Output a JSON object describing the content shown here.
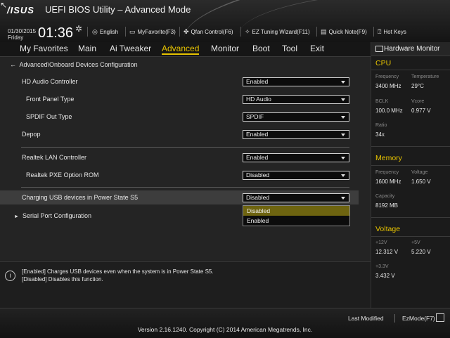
{
  "header": {
    "logo": "/ISUS",
    "title": "UEFI BIOS Utility – Advanced Mode",
    "date": "01/30/2015",
    "day": "Friday",
    "time": "01:36",
    "tools": [
      {
        "icon": "globe-icon",
        "label": "English"
      },
      {
        "icon": "monitor-icon",
        "label": "MyFavorite(F3)"
      },
      {
        "icon": "fan-icon",
        "label": "Qfan Control(F6)"
      },
      {
        "icon": "wand-icon",
        "label": "EZ Tuning Wizard(F11)"
      },
      {
        "icon": "note-icon",
        "label": "Quick Note(F9)"
      },
      {
        "icon": "question-icon",
        "label": "Hot Keys"
      }
    ]
  },
  "menu": {
    "items": [
      "My Favorites",
      "Main",
      "Ai Tweaker",
      "Advanced",
      "Monitor",
      "Boot",
      "Tool",
      "Exit"
    ],
    "active_index": 3
  },
  "breadcrumb": "Advanced\\Onboard Devices Configuration",
  "settings": [
    {
      "label": "HD Audio Controller",
      "value": "Enabled"
    },
    {
      "label": "Front Panel Type",
      "value": "HD Audio"
    },
    {
      "label": "SPDIF Out Type",
      "value": "SPDIF"
    },
    {
      "label": "Depop",
      "value": "Enabled"
    },
    {
      "label": "Realtek LAN Controller",
      "value": "Enabled"
    },
    {
      "label": "Realtek PXE Option ROM",
      "value": "Disabled"
    },
    {
      "label": "Charging USB devices in Power State S5",
      "value": "Disabled"
    }
  ],
  "dropdown_options": [
    "Disabled",
    "Enabled"
  ],
  "submenu": "Serial Port Configuration",
  "help": {
    "line1": "[Enabled] Charges USB devices even when the system is in Power State S5.",
    "line2": "[Disabled] Disables this function."
  },
  "hardware_monitor": {
    "title": "Hardware Monitor",
    "cpu": {
      "title": "CPU",
      "frequency_label": "Frequency",
      "frequency": "3400 MHz",
      "temperature_label": "Temperature",
      "temperature": "29°C",
      "bclk_label": "BCLK",
      "bclk": "100.0 MHz",
      "vcore_label": "Vcore",
      "vcore": "0.977 V",
      "ratio_label": "Ratio",
      "ratio": "34x"
    },
    "memory": {
      "title": "Memory",
      "frequency_label": "Frequency",
      "frequency": "1600 MHz",
      "voltage_label": "Voltage",
      "voltage": "1.650 V",
      "capacity_label": "Capacity",
      "capacity": "8192 MB"
    },
    "voltage": {
      "title": "Voltage",
      "v12_label": "+12V",
      "v12": "12.312 V",
      "v5_label": "+5V",
      "v5": "5.220 V",
      "v33_label": "+3.3V",
      "v33": "3.432 V"
    }
  },
  "footer": {
    "last_modified": "Last Modified",
    "ez_mode": "EzMode(F7)",
    "version": "Version 2.16.1240. Copyright (C) 2014 American Megatrends, Inc."
  },
  "colors": {
    "accent": "#e8c400",
    "selected_option": "#6e6410"
  }
}
